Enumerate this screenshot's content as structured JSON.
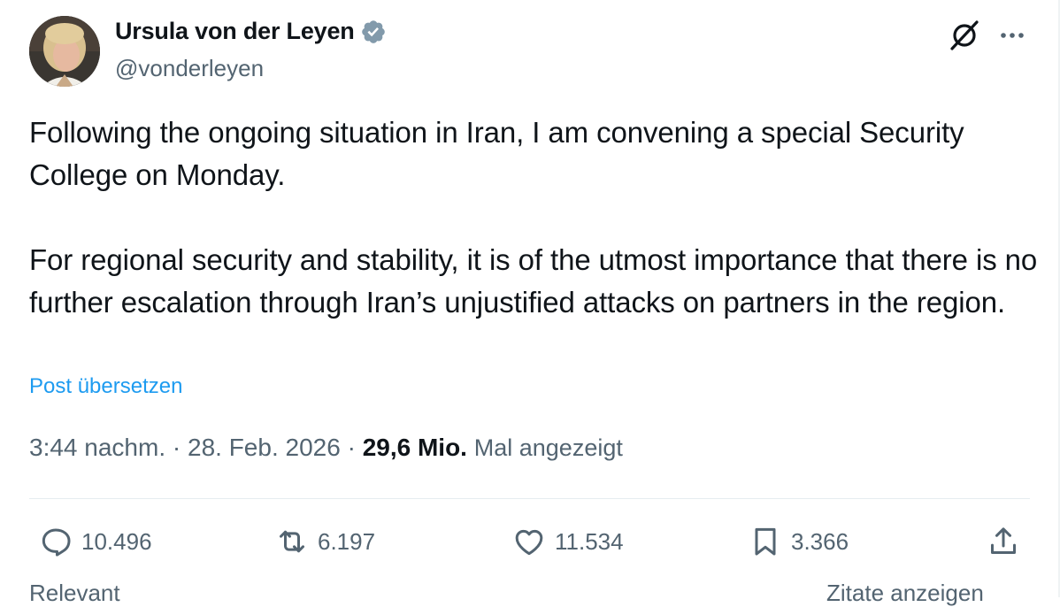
{
  "author": {
    "name": "Ursula von der Leyen",
    "handle": "@vonderleyen",
    "verified_icon": "verified-badge-icon",
    "verified_color": "#829aab"
  },
  "tweet": {
    "text": "Following the ongoing situation in Iran, I am convening a special Security College on Monday.\n\nFor regional security and stability, it is of the utmost importance that there is no further escalation through Iran’s unjustified attacks on partners in the region.",
    "translate_label": "Post übersetzen",
    "time": "3:44 nachm.",
    "separator": " · ",
    "date": "28. Feb. 2026",
    "views": "29,6 Mio.",
    "views_label": "Mal angezeigt"
  },
  "actions": {
    "replies": "10.496",
    "reposts": "6.197",
    "likes": "11.534",
    "bookmarks": "3.366"
  },
  "footer": {
    "sort_label": "Relevant",
    "quotes_label": "Zitate anzeigen"
  },
  "colors": {
    "text": "#0f1419",
    "secondary": "#536471",
    "link": "#1d9bf0"
  }
}
